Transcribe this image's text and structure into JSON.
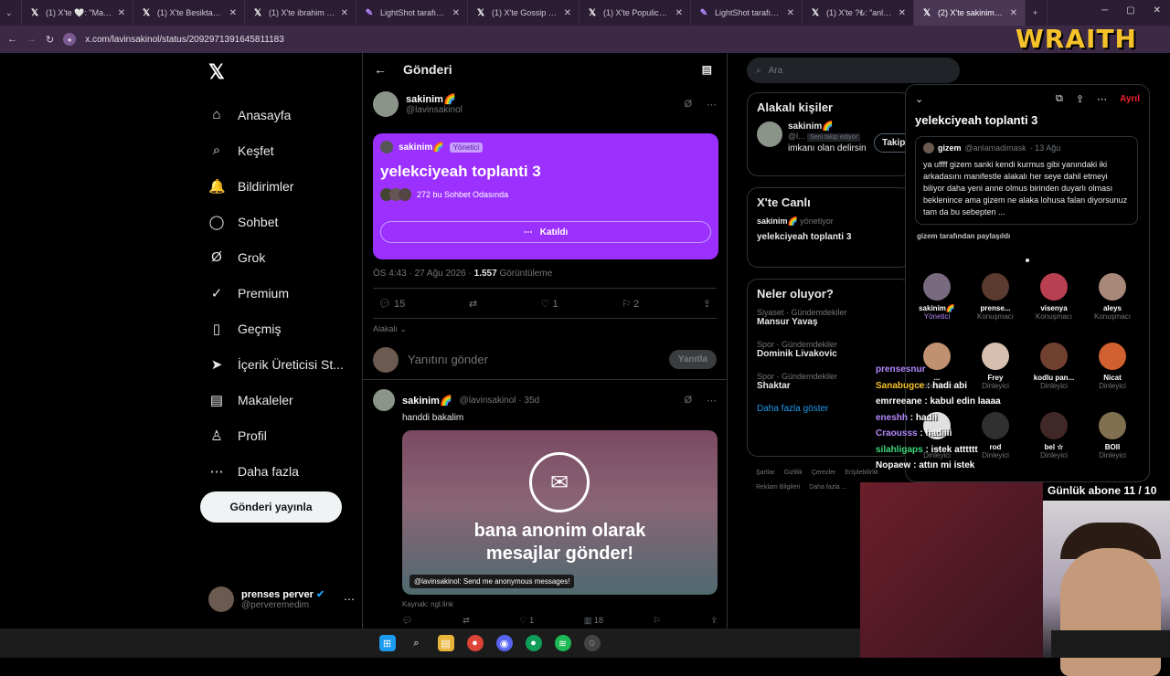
{
  "browser": {
    "tabs": [
      {
        "icon": "X",
        "title": "(1) X'te 🤍: \"Manifest"
      },
      {
        "icon": "X",
        "title": "(1) X'te Besiktasliyim"
      },
      {
        "icon": "X",
        "title": "(1) X'te ibrahim Hask"
      },
      {
        "icon": "LS",
        "title": "LightShot tarafından"
      },
      {
        "icon": "X",
        "title": "(1) X'te Gossip Maga"
      },
      {
        "icon": "X",
        "title": "(1) X'te Populicc: \"Me"
      },
      {
        "icon": "LS",
        "title": "LightShot tarafından"
      },
      {
        "icon": "X",
        "title": "(1) X'te ?₺: \"anlık gizem"
      },
      {
        "icon": "X",
        "title": "(2) X'te sakinim🌈"
      }
    ],
    "new_tab": "+",
    "url": "x.com/lavinsakinol/status/2092971391645811183"
  },
  "overlay": {
    "brand": "WRAITH",
    "sub_counter": "Günlük abone 11 / 10"
  },
  "leftnav": {
    "items": [
      {
        "icon": "⌂",
        "label": "Anasayfa"
      },
      {
        "icon": "⌕",
        "label": "Keşfet"
      },
      {
        "icon": "🔔",
        "label": "Bildirimler"
      },
      {
        "icon": "◯",
        "label": "Sohbet"
      },
      {
        "icon": "Ø",
        "label": "Grok"
      },
      {
        "icon": "✓",
        "label": "Premium"
      },
      {
        "icon": "▯",
        "label": "Geçmiş"
      },
      {
        "icon": "➤",
        "label": "İçerik Üreticisi St..."
      },
      {
        "icon": "▤",
        "label": "Makaleler"
      },
      {
        "icon": "♙",
        "label": "Profil"
      },
      {
        "icon": "⋯",
        "label": "Daha fazla"
      }
    ],
    "post_button": "Gönderi yayınla",
    "account": {
      "name": "prenses perver",
      "handle": "@perveremedim"
    }
  },
  "main": {
    "header": "Gönderi",
    "post": {
      "name": "sakinim🌈",
      "handle": "@lavinsakinol",
      "space": {
        "host": "sakinim🌈",
        "badge": "Yönetici",
        "title": "yelekciyeah toplanti 3",
        "listeners": "272 bu Sohbet Odasında",
        "join": "Katıldı"
      },
      "time": "ÖS 4:43 · 27 Ağu 2026 · ",
      "views": "1.557",
      "views_label": " Görüntüleme",
      "replies": "15",
      "likes": "1",
      "bookmarks": "2",
      "sort": "Alakalı"
    },
    "reply": {
      "placeholder": "Yanıtını gönder",
      "button": "Yanıtla"
    },
    "post2": {
      "name": "sakinim🌈",
      "handle": "@lavinsakinol · 35d",
      "text": "handdi bakalim",
      "card_text_1": "bana anonim olarak",
      "card_text_2": "mesajlar gönder!",
      "caption": "@lavinsakinol: Send me anonymous messages!",
      "source": "Kaynak: ngl.link",
      "likes": "1",
      "views": "18"
    }
  },
  "right": {
    "search_placeholder": "Ara",
    "relevant_title": "Alakalı kişiler",
    "relevant_person": {
      "name": "sakinim🌈",
      "handle": "@l...",
      "badge": "Seni takip ediyor",
      "bio": "imkanı olan delirsin",
      "follow": "Takip"
    },
    "live_title": "X'te Canlı",
    "live": {
      "host": "sakinim🌈",
      "role": "yönetiyor",
      "title": "yelekciyeah toplanti 3"
    },
    "trends_title": "Neler oluyor?",
    "trends": [
      {
        "cat": "Siyaset · Gündemdekiler",
        "name": "Mansur Yavaş"
      },
      {
        "cat": "Spor · Gündemdekiler",
        "name": "Dominik Livakovic"
      },
      {
        "cat": "Spor · Gündemdekiler",
        "name": "Shaktar"
      }
    ],
    "show_more": "Daha fazla göster",
    "footer": [
      "Şartlar",
      "Gizlilik",
      "Çerezler",
      "Erişilebilirlik",
      "Reklam Bilgileri",
      "Daha fazla ..."
    ]
  },
  "space_panel": {
    "leave": "Ayrıl",
    "title": "yelekciyeah toplanti 3",
    "quote": {
      "name": "gizem",
      "handle": "@anlamadimask",
      "date": "· 13 Ağu",
      "text": "ya uffff gizem sanki kendi kurmus gibi yanındaki iki arkadasını manifestle alakalı her seye dahil etmeyi biliyor daha yeni anne olmus birinden duyarlı olması beklenince ama gizem ne alaka lohusa falan diyorsunuz tam da bu sebepten ..."
    },
    "shared_by": "gizem tarafından paylaşıldı",
    "participants": [
      {
        "name": "sakinim🌈",
        "role": "Yönetici",
        "color": "#7a6a80"
      },
      {
        "name": "prense...",
        "role": "Konuşmacı",
        "color": "#5b3b30"
      },
      {
        "name": "visenya",
        "role": "Konuşmacı",
        "color": "#b84050"
      },
      {
        "name": "aleys",
        "role": "Konuşmacı",
        "color": "#a88878"
      },
      {
        "name": "...",
        "role": "Konuşmacı",
        "color": "#c09070"
      },
      {
        "name": "Frey",
        "role": "Dinleyici",
        "color": "#d8c0b0"
      },
      {
        "name": "kodlu pan...",
        "role": "Dinleyici",
        "color": "#704030"
      },
      {
        "name": "Nicat",
        "role": "Dinleyici",
        "color": "#d06030"
      },
      {
        "name": "...",
        "role": "Dinleyici",
        "color": "#e0e0e0"
      },
      {
        "name": "rod",
        "role": "Dinleyici",
        "color": "#303030"
      },
      {
        "name": "bel ☆",
        "role": "Dinleyici",
        "color": "#402828"
      },
      {
        "name": "BOII",
        "role": "Dinleyici",
        "color": "#807050"
      }
    ]
  },
  "chat": [
    {
      "user": "prensesnur",
      "msg": "",
      "color": "#b589ff"
    },
    {
      "user": "Sanabugce",
      "msg": " : hadi abi",
      "color": "#f5c22a"
    },
    {
      "user": "emrreeane",
      "msg": " : kabul edin laaaa",
      "color": "#ffffff"
    },
    {
      "user": "eneshh",
      "msg": " : hadii",
      "color": "#b589ff"
    },
    {
      "user": "Craousss",
      "msg": " : hadiiii",
      "color": "#b589ff"
    },
    {
      "user": "silahligaps",
      "msg": " : istek atttttt",
      "color": "#3fd97a"
    },
    {
      "user": "Nopaew",
      "msg": " : attın mi istek",
      "color": "#ffffff"
    }
  ]
}
